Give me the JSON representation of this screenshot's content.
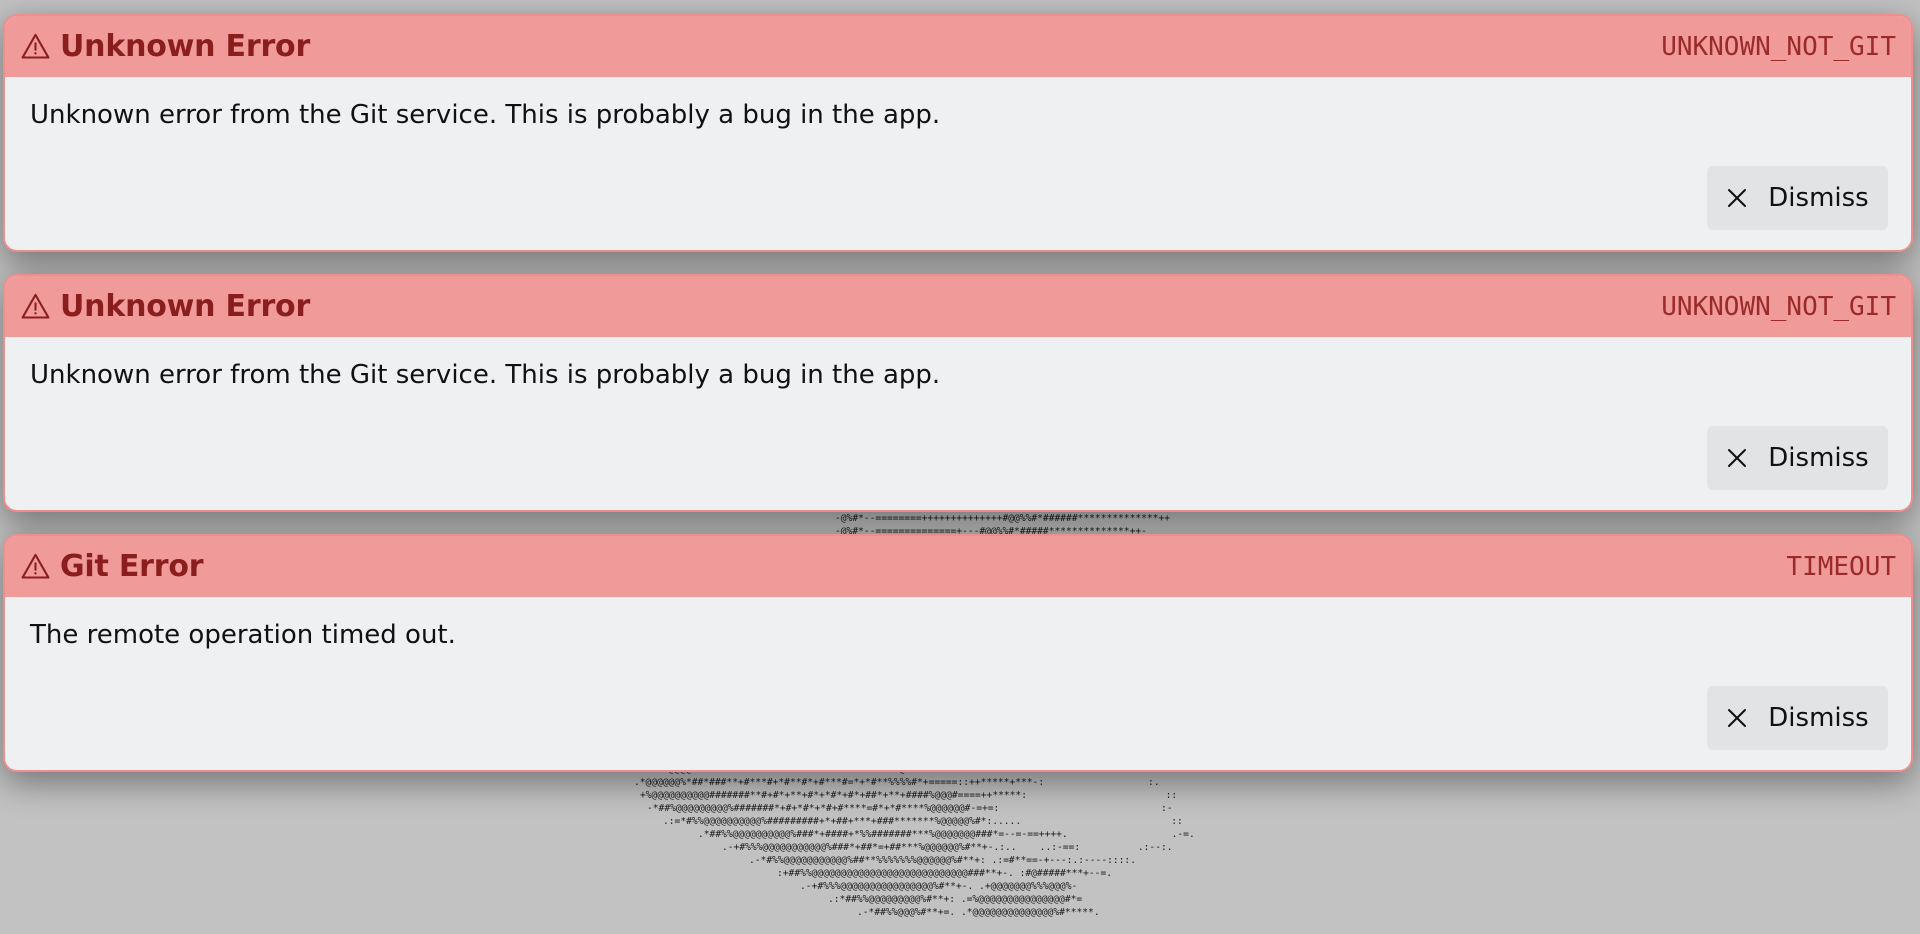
{
  "errors": [
    {
      "title": "Unknown Error",
      "code": "UNKNOWN_NOT_GIT",
      "message": "Unknown error from the Git service. This is probably a bug in the app.",
      "dismiss_label": "Dismiss",
      "icon": "warning-triangle-icon"
    },
    {
      "title": "Unknown Error",
      "code": "UNKNOWN_NOT_GIT",
      "message": "Unknown error from the Git service. This is probably a bug in the app.",
      "dismiss_label": "Dismiss",
      "icon": "warning-triangle-icon"
    },
    {
      "title": "Git Error",
      "code": "TIMEOUT",
      "message": "The remote operation timed out.",
      "dismiss_label": "Dismiss",
      "icon": "warning-triangle-icon"
    }
  ],
  "background_art": {
    "lines": [
      "-@@#*--======+++++++++*****#@@%%#*#####**************++",
      "-@%#*--========++++++++++++++#@@%%#*######**************++",
      "-@%#*--==============+---#@@%%#*#####**************++-",
      ".=%@@@@##*+*#+##*+#+##***+*+**+**#*+#**#*%%@#++=====--==+*=--=****++*+**+=:                .:.",
      ".*@@@@@@%*##*###**+#***#+*#**#*+#***#=*+*#**%%%%#*+=====::++*****+***-:                  :.",
      "+%@@@@@@@@@@#######**#+#*+**+#*+*#*+#*+##*+**+####%@@@#====++*****:                        ::",
      "-*##%@@@@@@@@@%#######*+#+*#*+*#+#****=#*+*#****%@@@@@@#-=+=:                            :-",
      ".:=*#%%@@@@@@@@@@%#########+*+##+***+###*******%@@@@@%#*:.....                          ::",
      ".*##%%@@@@@@@@@@%###*+####+*%%#######***%@@@@@@@###*=--=-==++++.                  .-=.",
      ".-+#%%%@@@@@@@@@@@%###*+##*=+##***%@@@@@@%#**+-.:..    ..:-==:          .:--:.",
      ".-*#%%@@@@@@@@@@@%##**%%%%%%%@@@@@@%#**+: .:=#**==-+---:.:----::::.",
      ":+##%%@@@@@@@@@@@@@@@@@@@@@@@@@@@###**+-. :#@#####***+--=.",
      ".-+#%%%@@@@@@@@@@@@@@@@%#**+-. .+@@@@@@@%%%@@@%-",
      ".:*##%%@@@@@@@@@%#**+: .=%@@@@@@@@@@@@@@@#*=",
      ".-*##%%@@@%#**+=. .*@@@@@@@@@@@@@@%#*****."
    ]
  }
}
